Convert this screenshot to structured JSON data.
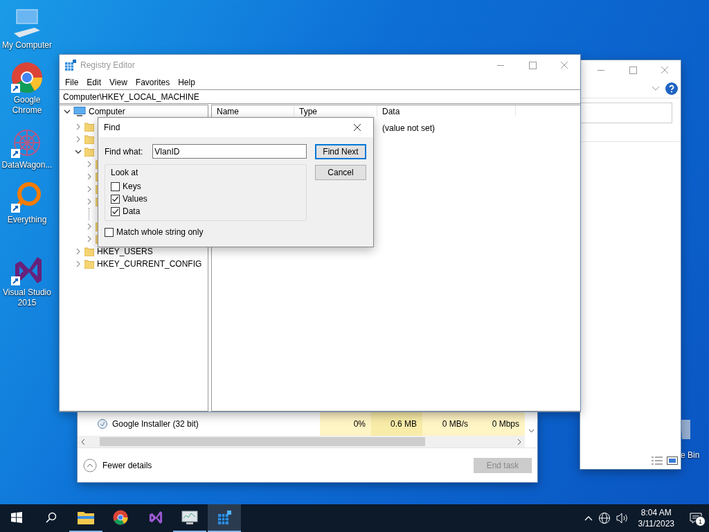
{
  "desktop_icons": [
    {
      "kind": "computer",
      "label": "My Computer",
      "shortcut": false
    },
    {
      "kind": "chrome",
      "label": "Google Chrome",
      "shortcut": true
    },
    {
      "kind": "datawagon",
      "label": "DataWagon...",
      "shortcut": true
    },
    {
      "kind": "everything",
      "label": "Everything",
      "shortcut": true
    },
    {
      "kind": "studio",
      "label": "Visual Studio 2015",
      "shortcut": true
    }
  ],
  "recycle_bin": {
    "label": "e Bin"
  },
  "task_manager": {
    "rows": [
      {
        "name": "Google Installer (32 bit)",
        "cells": [
          {
            "text": "0%",
            "color": "#fff4c4"
          },
          {
            "text": "0.6 MB",
            "color": "#f9eca8"
          },
          {
            "text": "0 MB/s",
            "color": "#fff4c4"
          },
          {
            "text": "0 Mbps",
            "color": "#fff4c4"
          }
        ]
      }
    ],
    "toggle": "Fewer details",
    "end_button": {
      "label": "End task",
      "disabled": true
    }
  },
  "registry_editor": {
    "title": "Registry Editor",
    "menu": [
      "File",
      "Edit",
      "View",
      "Favorites",
      "Help"
    ],
    "address": "Computer\\HKEY_LOCAL_MACHINE",
    "tree": {
      "label": "Computer",
      "expanded": true,
      "children": [
        {
          "expanded": false
        },
        {
          "expanded": false
        },
        {
          "expanded": true,
          "children": [
            {
              "kind": "key",
              "expanded": false
            },
            {
              "kind": "key",
              "expanded": false
            },
            {
              "kind": "key",
              "expanded": false
            },
            {
              "kind": "key",
              "expanded": false
            },
            {
              "kind": "leaf"
            },
            {
              "kind": "key",
              "expanded": false
            },
            {
              "kind": "key",
              "expanded": false
            }
          ]
        },
        {
          "label": "HKEY_USERS",
          "expanded": false
        },
        {
          "label": "HKEY_CURRENT_CONFIG",
          "expanded": false
        }
      ]
    },
    "columns": [
      "Name",
      "Type",
      "Data"
    ],
    "rows": [
      {
        "data": "(value not set)"
      }
    ]
  },
  "find_dialog": {
    "title": "Find",
    "find_label": "Find what:",
    "find_value": "VlanID",
    "buttons": [
      {
        "label": "Find Next",
        "default": true
      },
      {
        "label": "Cancel",
        "default": false
      }
    ],
    "group_label": "Look at",
    "options": [
      {
        "label": "Keys",
        "checked": false
      },
      {
        "label": "Values",
        "checked": true
      },
      {
        "label": "Data",
        "checked": true
      }
    ],
    "match_whole": {
      "label": "Match whole string only",
      "checked": false
    }
  },
  "taskbar": {
    "apps": [
      {
        "kind": "explorer",
        "open": true,
        "active": false
      },
      {
        "kind": "chrome",
        "open": false,
        "active": false
      },
      {
        "kind": "studio",
        "open": false,
        "active": false
      },
      {
        "kind": "monitor",
        "open": true,
        "active": false
      },
      {
        "kind": "registry",
        "open": true,
        "active": true
      }
    ],
    "time": "8:04 AM",
    "date": "3/11/2023",
    "notifications": "1"
  }
}
